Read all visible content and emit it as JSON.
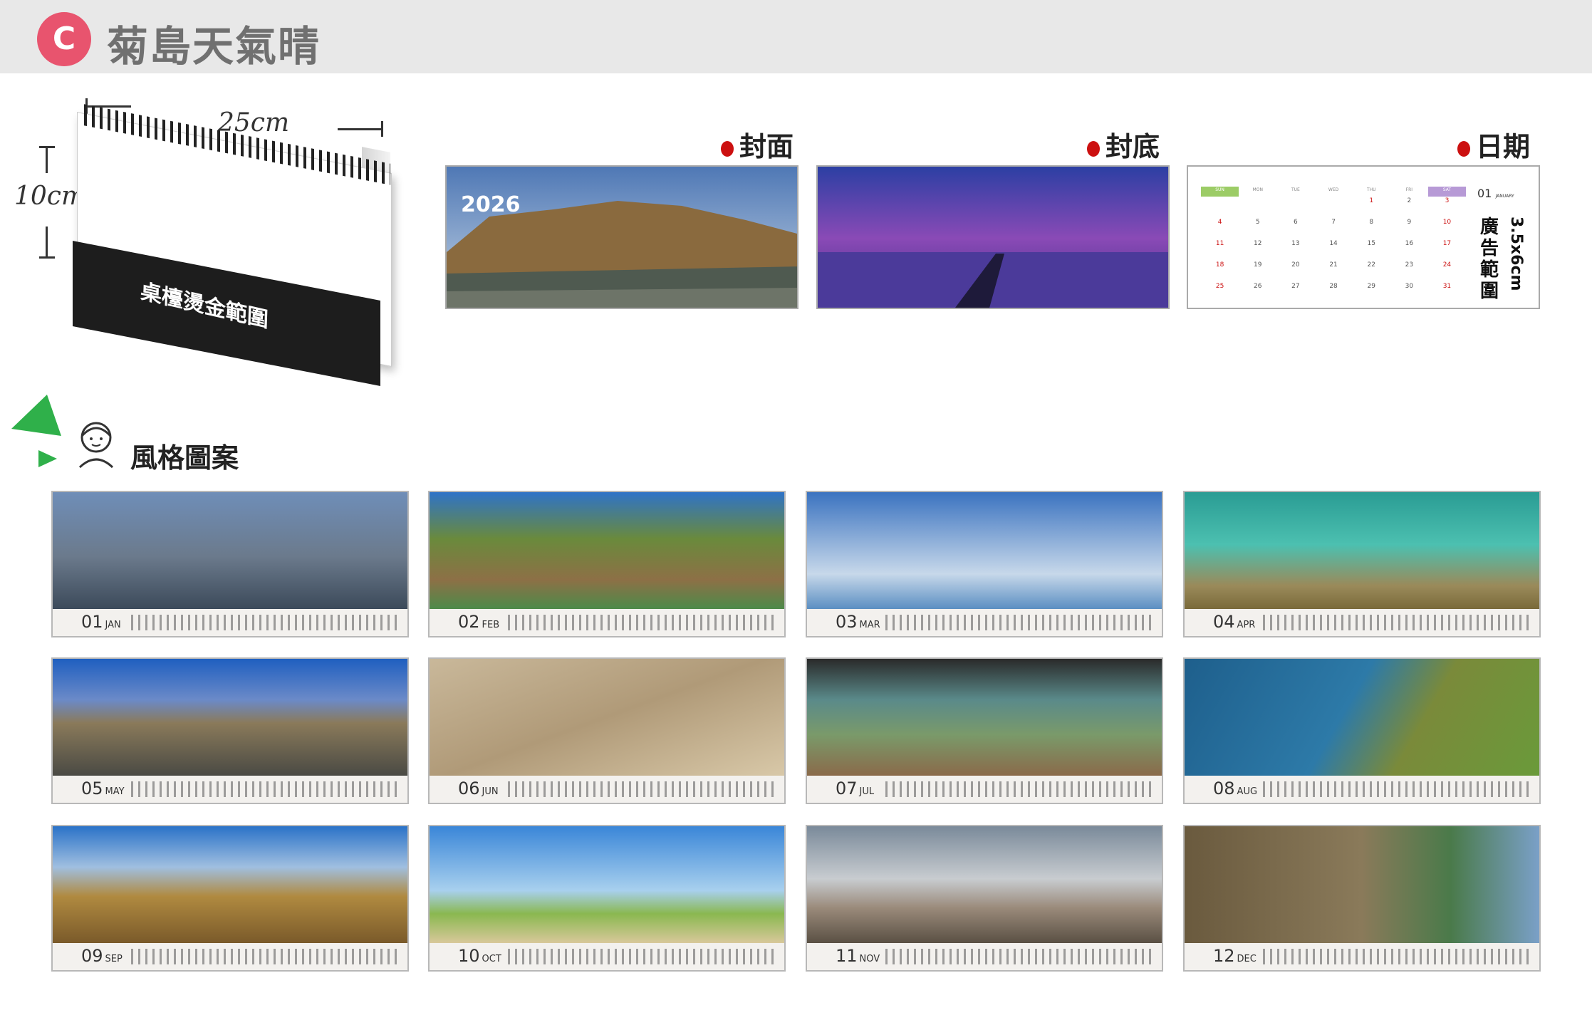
{
  "header": {
    "badge": "C",
    "title": "菊島天氣晴"
  },
  "mockup": {
    "width_label": "25cm",
    "height_label": "10cm",
    "band_text": "桌檯燙金範圍"
  },
  "labels": {
    "cover": "封面",
    "back": "封底",
    "date": "日期"
  },
  "cover": {
    "year": "2026"
  },
  "date_panel": {
    "weekdays": [
      "SUN",
      "MON",
      "TUE",
      "WED",
      "THU",
      "FRI",
      "SAT"
    ],
    "month": "01",
    "month_small": "JANUARY",
    "ad_label": "廣告範圍",
    "ad_size": "3.5x6cm",
    "days": [
      [
        "",
        "",
        "",
        "",
        "1",
        "2",
        "3"
      ],
      [
        "4",
        "5",
        "6",
        "7",
        "8",
        "9",
        "10"
      ],
      [
        "11",
        "12",
        "13",
        "14",
        "15",
        "16",
        "17"
      ],
      [
        "18",
        "19",
        "20",
        "21",
        "22",
        "23",
        "24"
      ],
      [
        "25",
        "26",
        "27",
        "28",
        "29",
        "30",
        "31"
      ]
    ]
  },
  "section": {
    "title": "風格圖案"
  },
  "months": [
    {
      "num": "01",
      "name": "JAN"
    },
    {
      "num": "02",
      "name": "FEB"
    },
    {
      "num": "03",
      "name": "MAR"
    },
    {
      "num": "04",
      "name": "APR"
    },
    {
      "num": "05",
      "name": "MAY"
    },
    {
      "num": "06",
      "name": "JUN"
    },
    {
      "num": "07",
      "name": "JUL"
    },
    {
      "num": "08",
      "name": "AUG"
    },
    {
      "num": "09",
      "name": "SEP"
    },
    {
      "num": "10",
      "name": "OCT"
    },
    {
      "num": "11",
      "name": "NOV"
    },
    {
      "num": "12",
      "name": "DEC"
    }
  ],
  "colors": {
    "badge": "#e8546e",
    "accent_red": "#cc1010",
    "triangle": "#2fb04a"
  }
}
